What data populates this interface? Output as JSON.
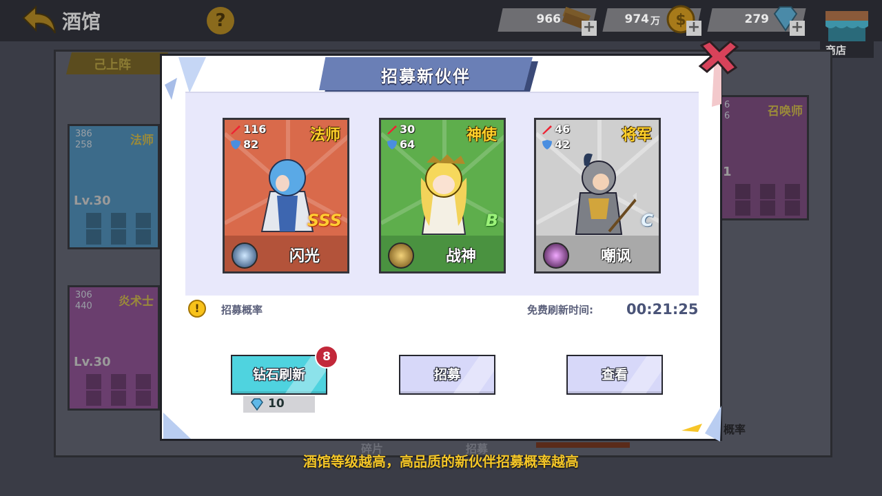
{
  "header": {
    "title": "酒馆",
    "help": "?",
    "resources": [
      {
        "name": "wood",
        "value": "966",
        "icon": "wood-plank-icon"
      },
      {
        "name": "gold",
        "value": "974",
        "unit": "万",
        "icon": "gold-coin-icon"
      },
      {
        "name": "diamond",
        "value": "279",
        "icon": "diamond-icon"
      }
    ],
    "shop_label": "商店"
  },
  "background": {
    "tab_label": "己上阵",
    "cards": [
      {
        "atk": "386",
        "def": "258",
        "level": "Lv.30",
        "class": "法师"
      },
      {
        "atk": "306",
        "def": "440",
        "level": "Lv.30",
        "class": "炎术士"
      },
      {
        "atk": "6",
        "def": "6",
        "level": "1",
        "class": "召唤师"
      }
    ],
    "rate_text": "概率",
    "fragment_text_1": "碎片",
    "fragment_text_2": "招募"
  },
  "modal": {
    "title": "招募新伙伴",
    "cards": [
      {
        "atk": "116",
        "def": "82",
        "class": "法师",
        "grade": "SSS",
        "skill_name": "闪光",
        "theme": "#d96a4b"
      },
      {
        "atk": "30",
        "def": "64",
        "class": "神使",
        "grade": "B",
        "skill_name": "战神",
        "theme": "#5eae4c"
      },
      {
        "atk": "46",
        "def": "42",
        "class": "将军",
        "grade": "C",
        "skill_name": "嘲讽",
        "theme": "#bdbdbd"
      }
    ],
    "rate_label": "招募概率",
    "timer_label": "免费刷新时间:",
    "timer_value": "00:21:25",
    "buttons": {
      "diamond_refresh": "钻石刷新",
      "recruit": "招募",
      "view": "查看"
    },
    "refresh_badge": "8",
    "refresh_cost": "10"
  },
  "caption": "酒馆等级越高，高品质的新伙伴招募概率越高",
  "colors": {
    "accent_banner": "#6a7fb6",
    "diamond_button": "#4fd3df",
    "light_button": "#d7d8f9",
    "caption": "#f4c628"
  }
}
